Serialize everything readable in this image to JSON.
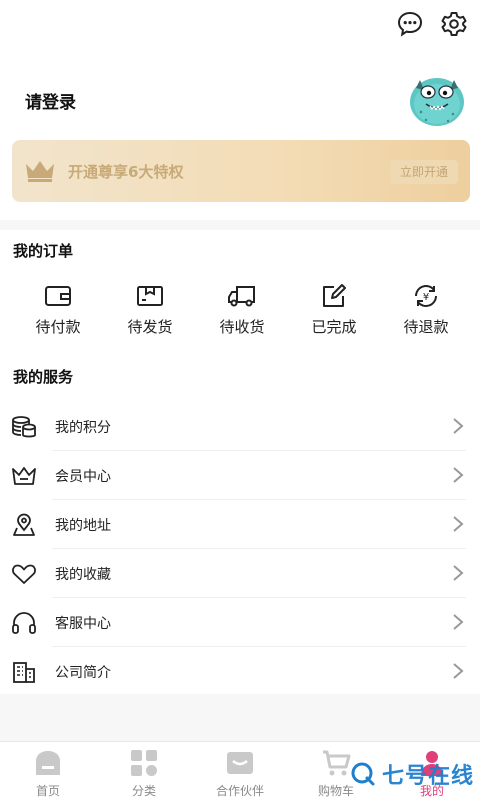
{
  "header": {
    "login_text": "请登录"
  },
  "vip": {
    "text": "开通尊享6大特权",
    "button": "立即开通",
    "colors": {
      "text": "#c7aa78",
      "crown": "#c7aa78"
    }
  },
  "orders": {
    "title": "我的订单",
    "items": [
      {
        "label": "待付款",
        "icon": "wallet-icon"
      },
      {
        "label": "待发货",
        "icon": "package-icon"
      },
      {
        "label": "待收货",
        "icon": "truck-icon"
      },
      {
        "label": "已完成",
        "icon": "edit-icon"
      },
      {
        "label": "待退款",
        "icon": "refund-icon"
      }
    ]
  },
  "services": {
    "title": "我的服务",
    "items": [
      {
        "label": "我的积分",
        "icon": "coins-icon"
      },
      {
        "label": "会员中心",
        "icon": "crown-icon"
      },
      {
        "label": "我的地址",
        "icon": "location-icon"
      },
      {
        "label": "我的收藏",
        "icon": "heart-icon"
      },
      {
        "label": "客服中心",
        "icon": "headset-icon"
      },
      {
        "label": "公司简介",
        "icon": "building-icon"
      }
    ]
  },
  "tabbar": {
    "items": [
      {
        "label": "首页",
        "icon": "home-icon"
      },
      {
        "label": "分类",
        "icon": "category-icon"
      },
      {
        "label": "合作伙伴",
        "icon": "partner-icon"
      },
      {
        "label": "购物车",
        "icon": "cart-icon"
      },
      {
        "label": "我的",
        "icon": "profile-icon"
      }
    ],
    "active_index": 4,
    "colors": {
      "active": "#e0407a",
      "inactive": "#8a8a8a"
    }
  },
  "watermark": {
    "text": "七号在线",
    "color": "#1f7fcf"
  }
}
